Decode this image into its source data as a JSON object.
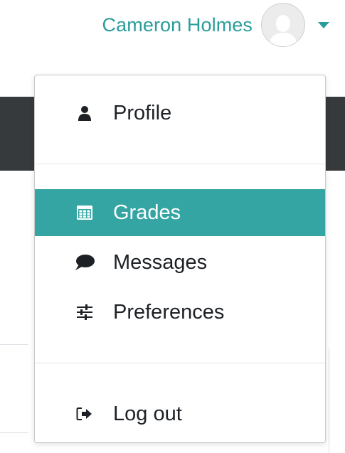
{
  "user": {
    "name": "Cameron Holmes",
    "avatar_icon": "user-silhouette-icon"
  },
  "menu": {
    "items": [
      {
        "label": "Profile",
        "icon": "user-icon"
      },
      {
        "label": "Grades",
        "icon": "grades-table-icon",
        "active": true
      },
      {
        "label": "Messages",
        "icon": "speech-bubble-icon"
      },
      {
        "label": "Preferences",
        "icon": "sliders-icon"
      },
      {
        "label": "Log out",
        "icon": "sign-out-icon"
      }
    ]
  },
  "colors": {
    "accent": "#35a5a3",
    "link": "#2a9d9b",
    "header_dark": "#373a3c"
  }
}
